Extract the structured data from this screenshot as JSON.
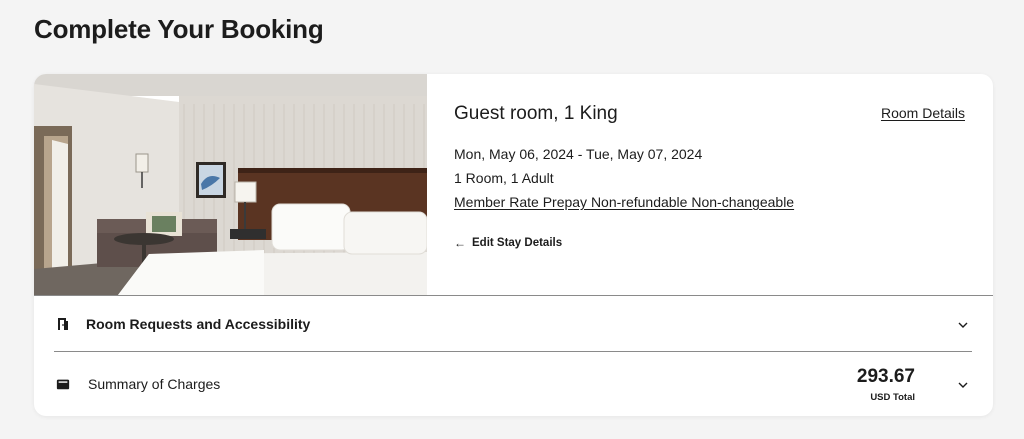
{
  "page": {
    "title": "Complete Your Booking"
  },
  "room": {
    "name": "Guest room, 1 King",
    "details_link": "Room Details",
    "dates": "Mon, May 06, 2024 - Tue, May 07, 2024",
    "occupancy": "1 Room, 1 Adult",
    "rate": "Member Rate Prepay Non-refundable Non-changeable",
    "edit_label": "Edit Stay Details",
    "photo_icon": "hotel-room-photo"
  },
  "sections": {
    "requests": {
      "label": "Room Requests and Accessibility",
      "icon": "door-icon"
    },
    "charges": {
      "label": "Summary of Charges",
      "icon": "wallet-icon",
      "total": "293.67",
      "total_caption": "USD Total"
    }
  },
  "colors": {
    "background": "#f4f4f4",
    "card": "#ffffff",
    "text": "#1c1c1c",
    "divider": "#8a8a8a"
  }
}
